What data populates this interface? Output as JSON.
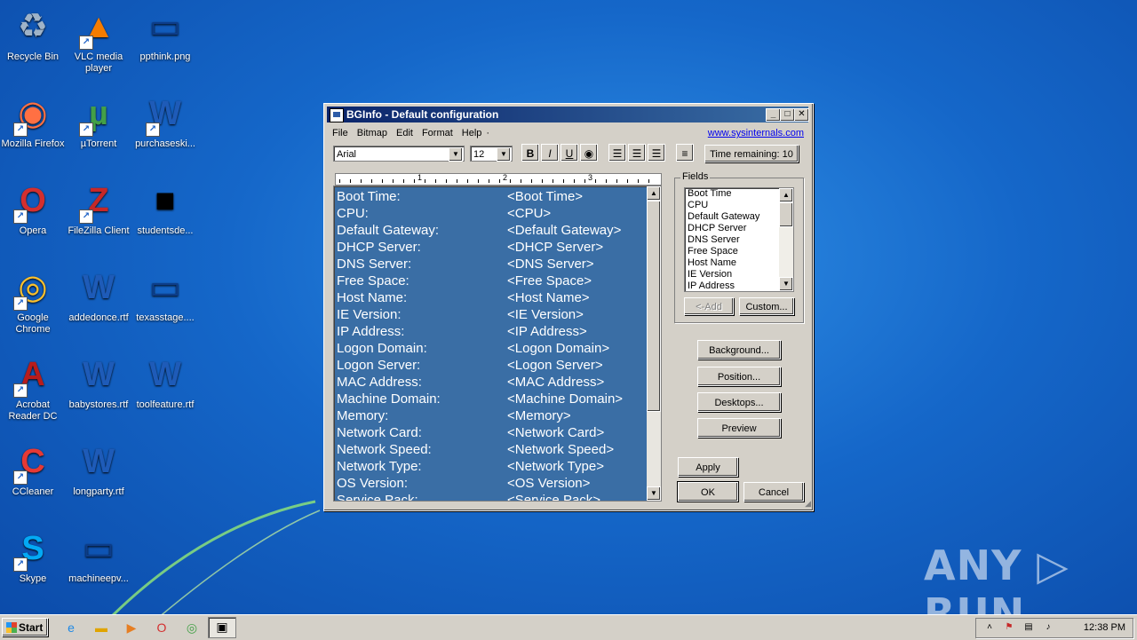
{
  "desktop": {
    "icons": [
      {
        "label": "Recycle Bin",
        "icon": "recycle-bin-icon"
      },
      {
        "label": "VLC media player",
        "icon": "vlc-icon"
      },
      {
        "label": "ppthink.png",
        "icon": "image-file-icon"
      },
      {
        "label": "Mozilla Firefox",
        "icon": "firefox-icon"
      },
      {
        "label": "µTorrent",
        "icon": "utorrent-icon"
      },
      {
        "label": "purchaseski...",
        "icon": "word-document-icon"
      },
      {
        "label": "Opera",
        "icon": "opera-icon"
      },
      {
        "label": "FileZilla Client",
        "icon": "filezilla-icon"
      },
      {
        "label": "studentsde...",
        "icon": "black-file-icon"
      },
      {
        "label": "Google Chrome",
        "icon": "chrome-icon"
      },
      {
        "label": "addedonce.rtf",
        "icon": "word-document-icon"
      },
      {
        "label": "texasstage....",
        "icon": "image-file-icon"
      },
      {
        "label": "Acrobat Reader DC",
        "icon": "acrobat-icon"
      },
      {
        "label": "babystores.rtf",
        "icon": "word-document-icon"
      },
      {
        "label": "toolfeature.rtf",
        "icon": "word-document-icon"
      },
      {
        "label": "CCleaner",
        "icon": "ccleaner-icon"
      },
      {
        "label": "longparty.rtf",
        "icon": "word-document-icon"
      },
      {
        "label": "Skype",
        "icon": "skype-icon"
      },
      {
        "label": "machineepv...",
        "icon": "image-file-icon"
      }
    ]
  },
  "window": {
    "title": "BGInfo - Default configuration",
    "menu": [
      "File",
      "Bitmap",
      "Edit",
      "Format",
      "Help"
    ],
    "menu_extra": "·",
    "link": "www.sysinternals.com",
    "font_name": "Arial",
    "font_size": "12",
    "format_buttons": {
      "bold": "B",
      "italic": "I",
      "underline": "U"
    },
    "time_remaining": "Time remaining: 10",
    "ruler_numbers": [
      "1",
      "2",
      "3"
    ],
    "editor_rows": [
      {
        "label": "Boot Time:",
        "value": "<Boot Time>"
      },
      {
        "label": "CPU:",
        "value": "<CPU>"
      },
      {
        "label": "Default Gateway:",
        "value": "<Default Gateway>"
      },
      {
        "label": "DHCP Server:",
        "value": "<DHCP Server>"
      },
      {
        "label": "DNS Server:",
        "value": "<DNS Server>"
      },
      {
        "label": "Free Space:",
        "value": "<Free Space>"
      },
      {
        "label": "Host Name:",
        "value": "<Host Name>"
      },
      {
        "label": "IE Version:",
        "value": "<IE Version>"
      },
      {
        "label": "IP Address:",
        "value": "<IP Address>"
      },
      {
        "label": "Logon Domain:",
        "value": "<Logon Domain>"
      },
      {
        "label": "Logon Server:",
        "value": "<Logon Server>"
      },
      {
        "label": "MAC Address:",
        "value": "<MAC Address>"
      },
      {
        "label": "Machine Domain:",
        "value": "<Machine Domain>"
      },
      {
        "label": "Memory:",
        "value": "<Memory>"
      },
      {
        "label": "Network Card:",
        "value": "<Network Card>"
      },
      {
        "label": "Network Speed:",
        "value": "<Network Speed>"
      },
      {
        "label": "Network Type:",
        "value": "<Network Type>"
      },
      {
        "label": "OS Version:",
        "value": "<OS Version>"
      },
      {
        "label": "Service Pack:",
        "value": "<Service Pack>"
      }
    ],
    "fields_label": "Fields",
    "fields": [
      "Boot Time",
      "CPU",
      "Default Gateway",
      "DHCP Server",
      "DNS Server",
      "Free Space",
      "Host Name",
      "IE Version",
      "IP Address"
    ],
    "add_button": "<-Add",
    "custom_button": "Custom...",
    "background_button": "Background...",
    "position_button": "Position...",
    "desktops_button": "Desktops...",
    "preview_button": "Preview",
    "apply_button": "Apply",
    "ok_button": "OK",
    "cancel_button": "Cancel"
  },
  "taskbar": {
    "start_label": "Start",
    "clock": "12:38 PM"
  },
  "watermark": "ANY ▷ RUN"
}
